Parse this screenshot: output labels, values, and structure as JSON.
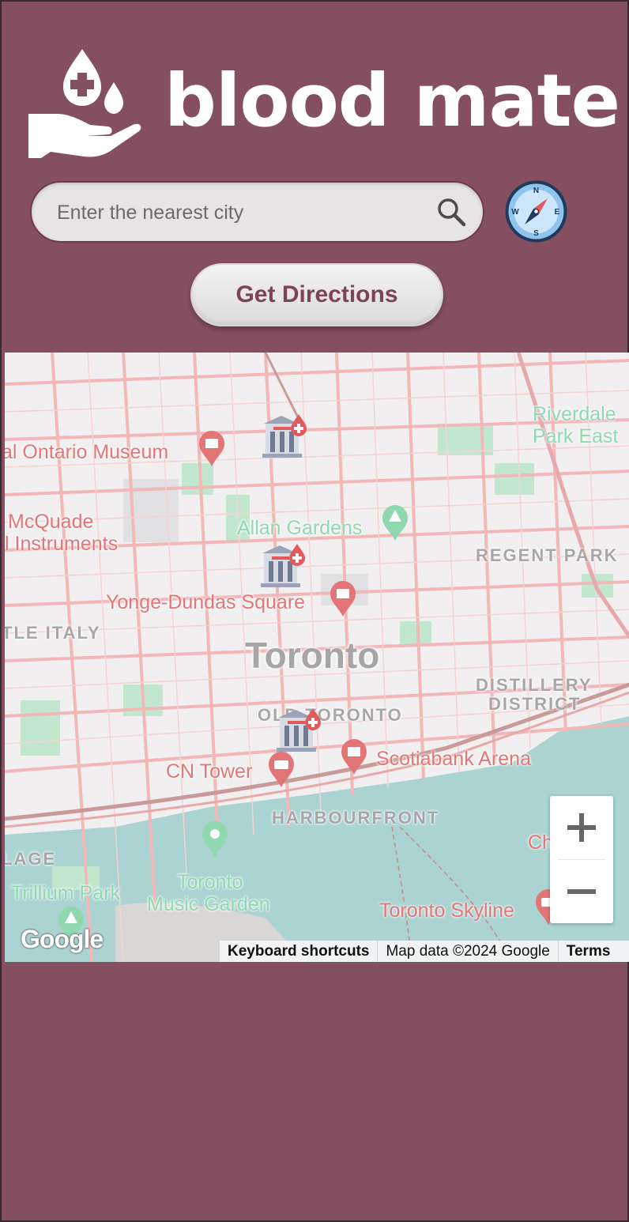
{
  "header": {
    "brand_name": "blood mate",
    "logo_icon": "hand-with-blood-drops-icon"
  },
  "search": {
    "placeholder": "Enter the nearest city",
    "value": "",
    "icon": "search-icon"
  },
  "locate_button": {
    "icon": "compass-icon",
    "directions": {
      "n": "N",
      "e": "E",
      "s": "S",
      "w": "W"
    }
  },
  "directions_button": {
    "label": "Get Directions"
  },
  "map": {
    "city_label": "Toronto",
    "pois": [
      "al Ontario Museum",
      "McQuade",
      "l Instruments",
      "Yonge-Dundas Square",
      "CN Tower",
      "Scotiabank Arena",
      "Toronto Skyline",
      "Ch"
    ],
    "parks": [
      "Riverdale",
      "Park East",
      "Allan Gardens",
      "Trillium Park",
      "Toronto",
      "Music Garden"
    ],
    "neighbourhoods": [
      "REGENT PARK",
      "TLE ITALY",
      "DISTILLERY",
      "DISTRICT",
      "OLD TORONTO",
      "HARBOURFRONT",
      "LAGE"
    ],
    "blood_bank_markers": [
      "hospital-blood-icon",
      "hospital-blood-icon",
      "hospital-blood-icon"
    ],
    "zoom_in_label": "+",
    "zoom_out_label": "−",
    "google_logo": "Google",
    "attribution": {
      "shortcuts": "Keyboard shortcuts",
      "data": "Map data ©2024 Google",
      "terms": "Terms"
    },
    "colors": {
      "road": "#f2b7b7",
      "water": "#aad3d2",
      "park": "#c2e7cf",
      "land": "#f1efef"
    }
  },
  "theme": {
    "background": "#844f60",
    "button_text": "#7b4457"
  }
}
